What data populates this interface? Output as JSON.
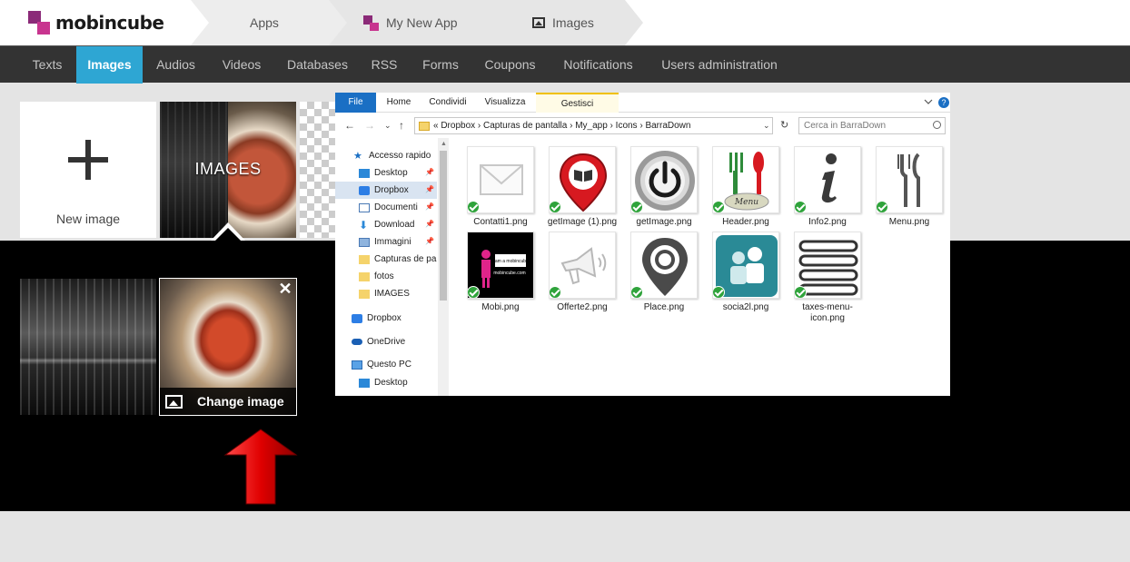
{
  "brand": {
    "name": "mobincube",
    "colors": {
      "primary": "#8b2a78",
      "secondary": "#c8348f",
      "accent": "#2ea6d3"
    }
  },
  "breadcrumbs": [
    {
      "label": "Apps",
      "icon": ""
    },
    {
      "label": "My New App",
      "icon": "app-icon"
    },
    {
      "label": "Images",
      "icon": "image-icon"
    }
  ],
  "nav": {
    "items": [
      "Texts",
      "Images",
      "Audios",
      "Videos",
      "Databases",
      "RSS",
      "Forms",
      "Coupons",
      "Notifications",
      "Users administration"
    ],
    "active": "Images"
  },
  "gallery": {
    "new_image_label": "New image",
    "folder_label": "IMAGES"
  },
  "editor": {
    "close_label": "✕",
    "change_image_label": "Change image"
  },
  "explorer": {
    "ribbon": {
      "file": "File",
      "home": "Home",
      "share": "Condividi",
      "view": "Visualizza",
      "manage": "Gestisci"
    },
    "address": "«  Dropbox  ›  Capturas de pantalla  ›  My_app  ›  Icons  ›  BarraDown",
    "search_placeholder": "Cerca in BarraDown",
    "nav_pane": [
      "Accesso rapido",
      "Desktop",
      "Dropbox",
      "Documenti",
      "Download",
      "Immagini",
      "Capturas de pan",
      "fotos",
      "IMAGES",
      "Dropbox",
      "OneDrive",
      "Questo PC",
      "Desktop"
    ],
    "files": [
      "Contatti1.png",
      "getImage (1).png",
      "getImage.png",
      "Header.png",
      "Info2.png",
      "Menu.png",
      "Mobi.png",
      "Offerte2.png",
      "Place.png",
      "socia2l.png",
      "taxes-menu-icon.png"
    ],
    "mobi_text": {
      "top": "I am a mobincube",
      "bottom": "mobincube.com"
    },
    "menu_text": "Menu"
  }
}
